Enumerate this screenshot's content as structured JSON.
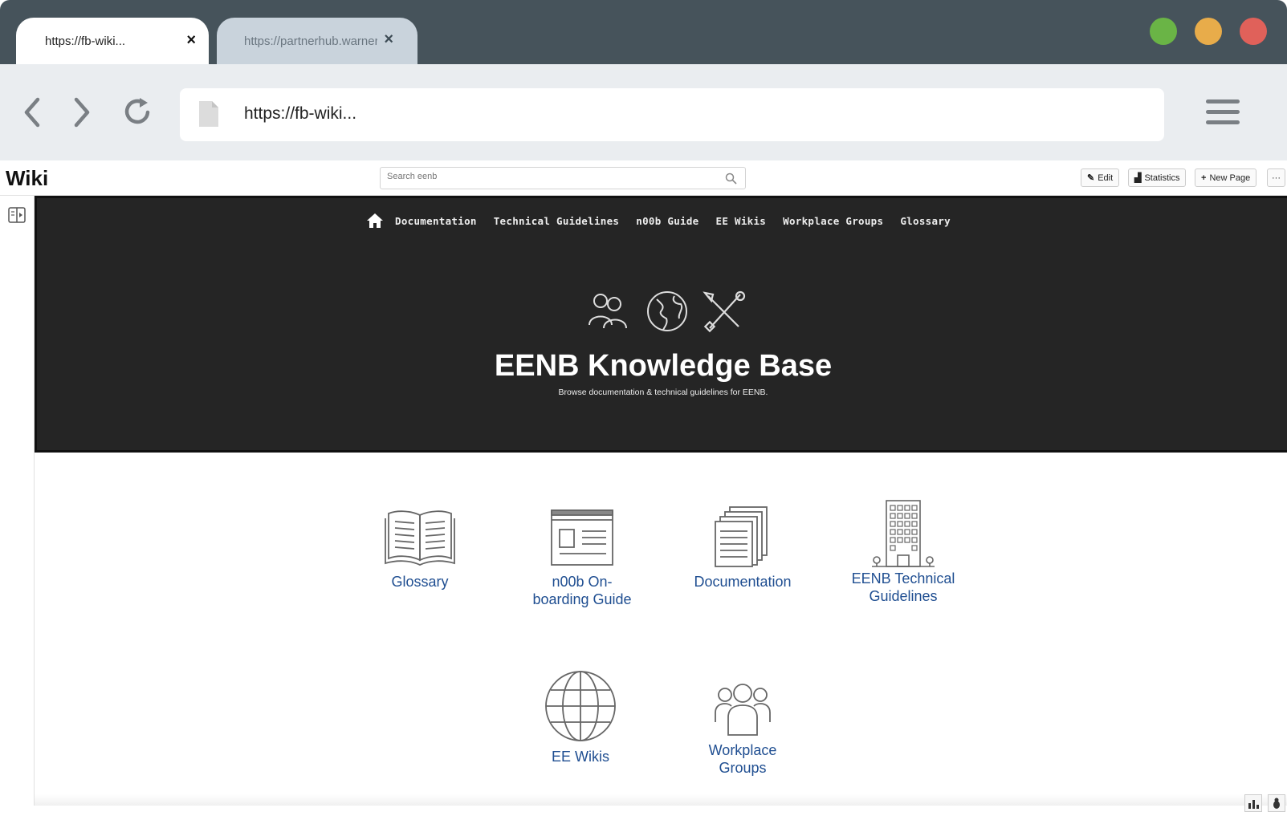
{
  "browser": {
    "tabs": [
      {
        "title": "https://fb-wiki...",
        "active": true
      },
      {
        "title": "https://partnerhub.warner...",
        "active": false
      }
    ],
    "tab_close_symbol": "×",
    "url": "https://fb-wiki...",
    "window_controls": [
      "green-maximize",
      "yellow-minimize",
      "red-close"
    ]
  },
  "wiki": {
    "logo": "Wiki",
    "search_placeholder": "Search eenb",
    "actions": {
      "edit": "Edit",
      "statistics": "Statistics",
      "new_page": "New Page",
      "more": "···"
    }
  },
  "hero": {
    "nav": [
      "Documentation",
      "Technical Guidelines",
      "n00b Guide",
      "EE Wikis",
      "Workplace Groups",
      "Glossary"
    ],
    "icons": [
      "people-icon",
      "globe-icon",
      "tools-icon"
    ],
    "title": "EENB Knowledge Base",
    "subtitle": "Browse documentation & technical guidelines for EENB."
  },
  "tiles": [
    {
      "label": "Glossary",
      "icon": "book-icon"
    },
    {
      "label": "n00b On-boarding Guide",
      "icon": "newspaper-icon"
    },
    {
      "label": "Documentation",
      "icon": "documents-icon"
    },
    {
      "label": "EENB Technical Guidelines",
      "icon": "building-icon"
    },
    {
      "label": "EE Wikis",
      "icon": "globe-icon"
    },
    {
      "label": "Workplace Groups",
      "icon": "group-icon"
    }
  ],
  "colors": {
    "titlebar": "#46535b",
    "toolbar": "#eaedf0",
    "hero_bg": "#252525",
    "link": "#1f4e91"
  }
}
